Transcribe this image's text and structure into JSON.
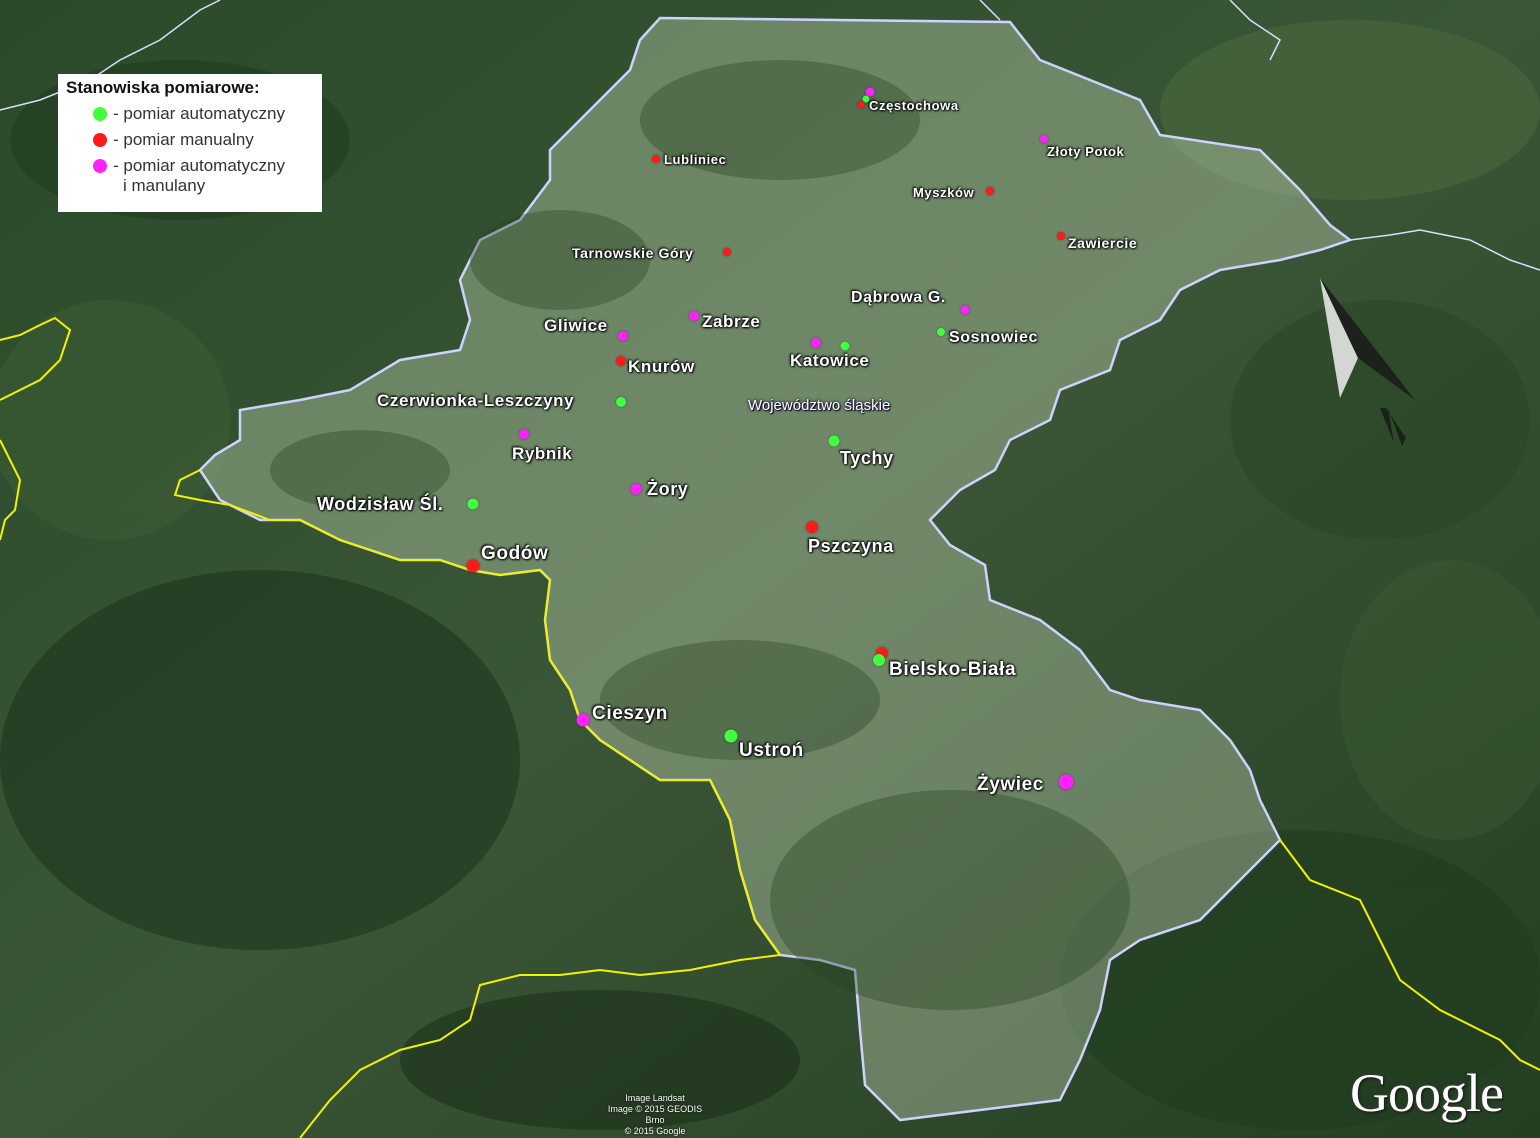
{
  "legend": {
    "title": "Stanowiska pomiarowe:",
    "items": [
      {
        "type": "auto",
        "label": "- pomiar automatyczny",
        "color": "#3fff3f"
      },
      {
        "type": "manual",
        "label": "- pomiar manualny",
        "color": "#ff1a1a"
      },
      {
        "type": "both",
        "label": "- pomiar automatyczny",
        "label_line2": "i manulany",
        "color": "#ff22ff"
      }
    ]
  },
  "region_label": "Województwo śląskie",
  "stations": [
    {
      "name": "Częstochowa",
      "types": [
        "both",
        "auto",
        "manual"
      ]
    },
    {
      "name": "Lubliniec",
      "types": [
        "manual"
      ]
    },
    {
      "name": "Złoty Potok",
      "types": [
        "both"
      ]
    },
    {
      "name": "Myszków",
      "types": [
        "manual"
      ]
    },
    {
      "name": "Zawiercie",
      "types": [
        "manual"
      ]
    },
    {
      "name": "Tarnowskie Góry",
      "types": [
        "manual"
      ]
    },
    {
      "name": "Dąbrowa G.",
      "types": [
        "both"
      ]
    },
    {
      "name": "Sosnowiec",
      "types": [
        "auto"
      ]
    },
    {
      "name": "Zabrze",
      "types": [
        "both"
      ]
    },
    {
      "name": "Gliwice",
      "types": [
        "both"
      ]
    },
    {
      "name": "Katowice",
      "types": [
        "both",
        "auto"
      ]
    },
    {
      "name": "Knurów",
      "types": [
        "manual"
      ]
    },
    {
      "name": "Czerwionka-Leszczyny",
      "types": [
        "auto"
      ]
    },
    {
      "name": "Rybnik",
      "types": [
        "both"
      ]
    },
    {
      "name": "Tychy",
      "types": [
        "auto"
      ]
    },
    {
      "name": "Żory",
      "types": [
        "both"
      ]
    },
    {
      "name": "Wodzisław Śl.",
      "types": [
        "auto"
      ]
    },
    {
      "name": "Pszczyna",
      "types": [
        "manual"
      ]
    },
    {
      "name": "Godów",
      "types": [
        "manual"
      ]
    },
    {
      "name": "Bielsko-Biała",
      "types": [
        "manual",
        "auto"
      ]
    },
    {
      "name": "Cieszyn",
      "types": [
        "both"
      ]
    },
    {
      "name": "Ustroń",
      "types": [
        "auto"
      ]
    },
    {
      "name": "Żywiec",
      "types": [
        "both"
      ]
    }
  ],
  "attribution": {
    "line1": "Image Landsat",
    "line2": "Image © 2015 GEODIS Brno",
    "line3": "© 2015 Google"
  },
  "logo": "Google",
  "colors": {
    "auto": "#3fff3f",
    "manual": "#ff1a1a",
    "both": "#ff22ff",
    "region_border": "#cfd2ff",
    "country_border": "#f2f200"
  }
}
